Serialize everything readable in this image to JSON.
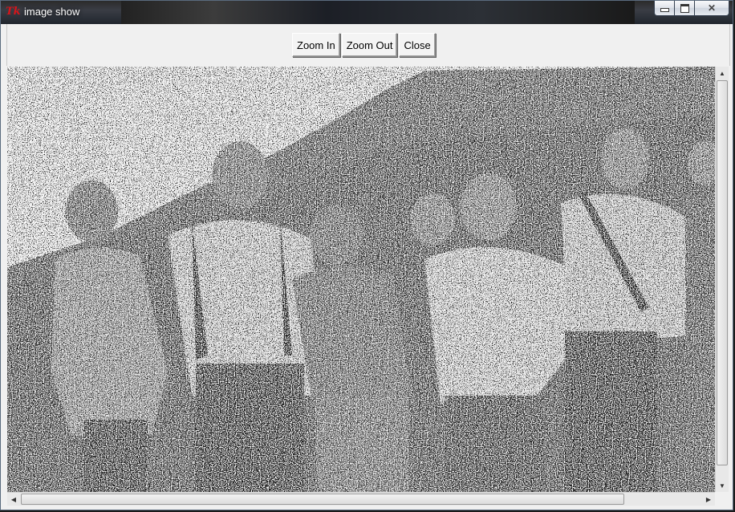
{
  "window": {
    "title": "image show",
    "icon": "tk-feather-icon",
    "controls": {
      "minimize": "minimize-icon",
      "maximize": "maximize-icon",
      "close": "close-icon"
    }
  },
  "toolbar": {
    "zoom_in_label": "Zoom In",
    "zoom_out_label": "Zoom Out",
    "close_label": "Close"
  },
  "image": {
    "description_alt": "group photo",
    "style": "grayscale with salt-and-pepper noise"
  },
  "scrollbars": {
    "vertical": {
      "up_icon": "arrow-up-icon",
      "down_icon": "arrow-down-icon",
      "position": 0.0
    },
    "horizontal": {
      "left_icon": "arrow-left-icon",
      "right_icon": "arrow-right-icon",
      "position": 0.0
    }
  },
  "colors": {
    "window_bg": "#f0f0f0",
    "title_icon": "#d8141a"
  }
}
